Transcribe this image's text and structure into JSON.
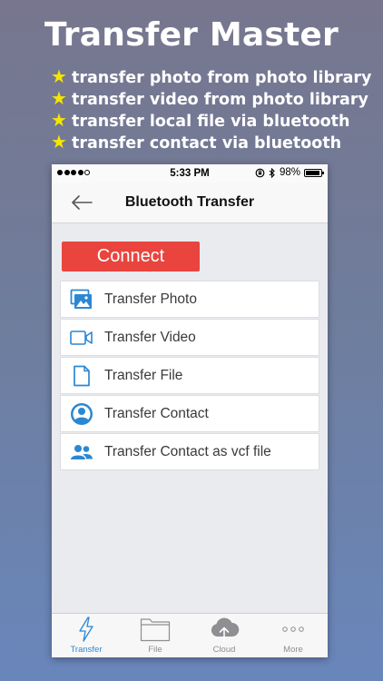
{
  "promo": {
    "title": "Transfer Master",
    "features": [
      "transfer photo from photo library",
      "transfer video from photo library",
      "transfer local file via bluetooth",
      "transfer contact via bluetooth"
    ]
  },
  "status_bar": {
    "time": "5:33 PM",
    "battery": "98%"
  },
  "nav": {
    "title": "Bluetooth Transfer",
    "back_icon": "back-arrow-icon"
  },
  "connect_label": "Connect",
  "menu": [
    {
      "label": "Transfer Photo",
      "icon": "photo-icon"
    },
    {
      "label": "Transfer Video",
      "icon": "video-icon"
    },
    {
      "label": "Transfer File",
      "icon": "file-icon"
    },
    {
      "label": "Transfer Contact",
      "icon": "contact-icon"
    },
    {
      "label": "Transfer Contact as vcf file",
      "icon": "group-contacts-icon"
    }
  ],
  "tabs": [
    {
      "label": "Transfer",
      "icon": "lightning-icon",
      "active": true
    },
    {
      "label": "File",
      "icon": "folder-icon",
      "active": false
    },
    {
      "label": "Cloud",
      "icon": "cloud-upload-icon",
      "active": false
    },
    {
      "label": "More",
      "icon": "more-dots-icon",
      "active": false
    }
  ],
  "colors": {
    "accent": "#2c87d3",
    "connect": "#e9453e",
    "star": "#f6e600"
  }
}
